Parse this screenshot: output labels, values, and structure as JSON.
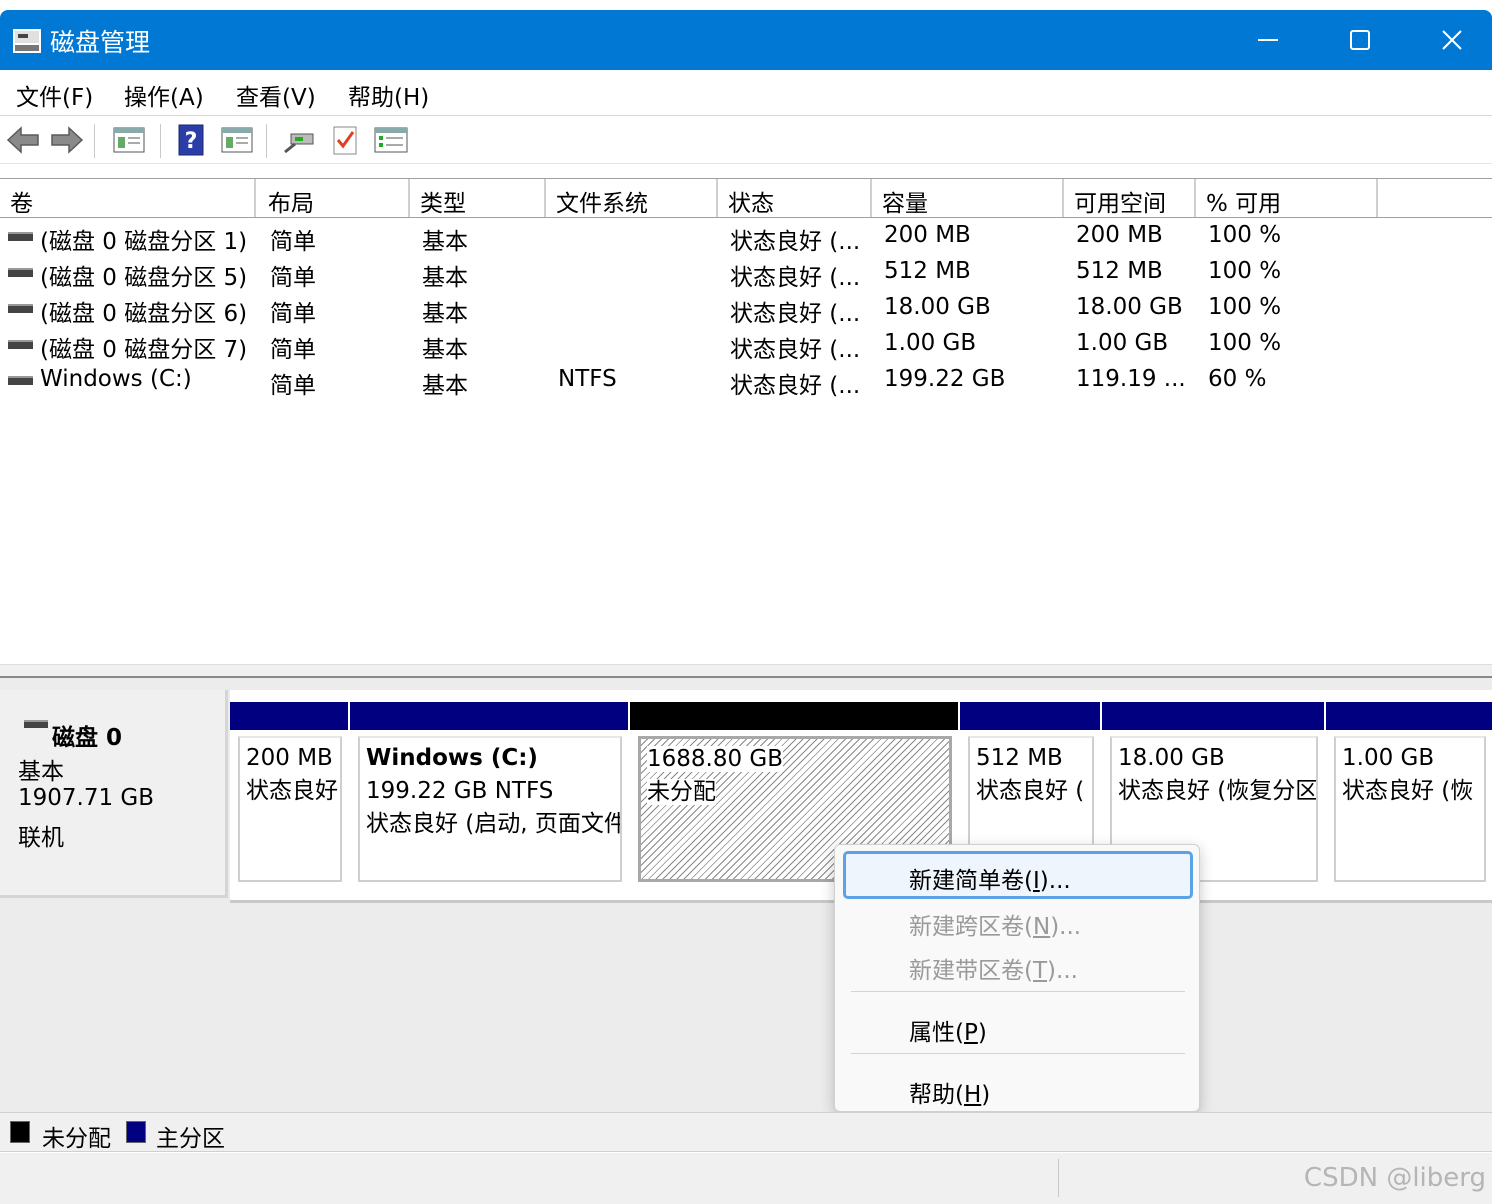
{
  "window": {
    "title": "磁盘管理",
    "minimize_icon": "minimize-icon",
    "maximize_icon": "maximize-icon",
    "close_icon": "close-icon"
  },
  "menu": [
    "文件(F)",
    "操作(A)",
    "查看(V)",
    "帮助(H)"
  ],
  "toolbar": {
    "buttons": [
      "back-arrow-icon",
      "forward-arrow-icon",
      "console-tree-icon",
      "help-icon",
      "action-pane-icon",
      "connect-icon",
      "check-icon",
      "properties-list-icon"
    ]
  },
  "table": {
    "columns": [
      "卷",
      "布局",
      "类型",
      "文件系统",
      "状态",
      "容量",
      "可用空间",
      "% 可用"
    ],
    "rows": [
      {
        "volume": "(磁盘 0 磁盘分区 1)",
        "layout": "简单",
        "type": "基本",
        "fs": "",
        "status": "状态良好 (...",
        "capacity": "200 MB",
        "free": "200 MB",
        "pct": "100 %"
      },
      {
        "volume": "(磁盘 0 磁盘分区 5)",
        "layout": "简单",
        "type": "基本",
        "fs": "",
        "status": "状态良好 (...",
        "capacity": "512 MB",
        "free": "512 MB",
        "pct": "100 %"
      },
      {
        "volume": "(磁盘 0 磁盘分区 6)",
        "layout": "简单",
        "type": "基本",
        "fs": "",
        "status": "状态良好 (...",
        "capacity": "18.00 GB",
        "free": "18.00 GB",
        "pct": "100 %"
      },
      {
        "volume": "(磁盘 0 磁盘分区 7)",
        "layout": "简单",
        "type": "基本",
        "fs": "",
        "status": "状态良好 (...",
        "capacity": "1.00 GB",
        "free": "1.00 GB",
        "pct": "100 %"
      },
      {
        "volume": "Windows (C:)",
        "layout": "简单",
        "type": "基本",
        "fs": "NTFS",
        "status": "状态良好 (...",
        "capacity": "199.22 GB",
        "free": "119.19 ...",
        "pct": "60 %"
      }
    ]
  },
  "disk": {
    "name": "磁盘 0",
    "type": "基本",
    "size": "1907.71 GB",
    "state": "联机"
  },
  "partitions": [
    {
      "title": "",
      "size": "200 MB",
      "status": "状态良好",
      "kind": "primary"
    },
    {
      "title": "Windows  (C:)",
      "size": "199.22 GB NTFS",
      "status": "状态良好 (启动, 页面文件",
      "kind": "primary"
    },
    {
      "title": "",
      "size": "1688.80 GB",
      "status": "未分配",
      "kind": "unallocated"
    },
    {
      "title": "",
      "size": "512 MB",
      "status": "状态良好 (",
      "kind": "primary"
    },
    {
      "title": "",
      "size": "18.00 GB",
      "status": "状态良好 (恢复分区",
      "kind": "primary"
    },
    {
      "title": "",
      "size": "1.00 GB",
      "status": "状态良好 (恢",
      "kind": "primary"
    }
  ],
  "context_menu": {
    "new_simple": {
      "label": "新建简单卷(I)...",
      "accel": "I"
    },
    "new_spanned": {
      "label": "新建跨区卷(N)...",
      "accel": "N"
    },
    "new_striped": {
      "label": "新建带区卷(T)...",
      "accel": "T"
    },
    "properties": {
      "label": "属性(P)",
      "accel": "P"
    },
    "help": {
      "label": "帮助(H)",
      "accel": "H"
    }
  },
  "legend": [
    {
      "label": "未分配",
      "color": "#000000"
    },
    {
      "label": "主分区",
      "color": "#000080"
    }
  ],
  "watermark": "CSDN @liberg",
  "colors": {
    "titlebar": "#0078d4",
    "primary_partition": "#000080",
    "unallocated": "#000000",
    "menu_highlight": "#5ba3e6"
  }
}
